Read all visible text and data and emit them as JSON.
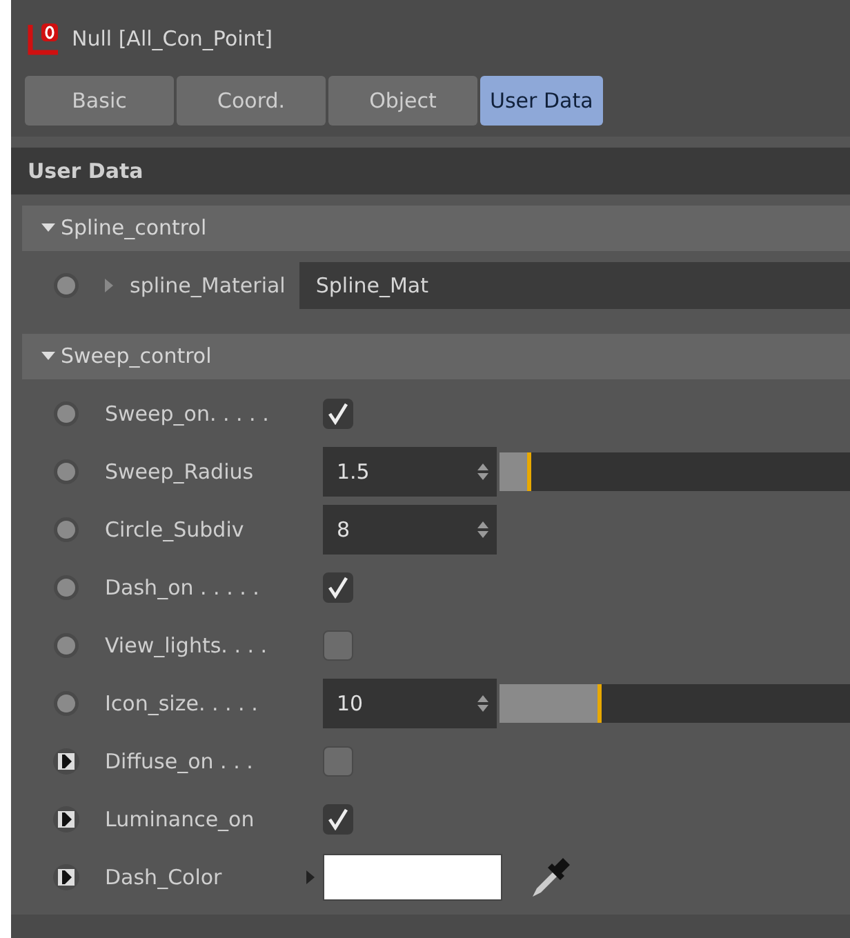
{
  "window": {
    "title": "Null [All_Con_Point]"
  },
  "tabs": [
    {
      "label": "Basic",
      "selected": false
    },
    {
      "label": "Coord.",
      "selected": false
    },
    {
      "label": "Object",
      "selected": false
    },
    {
      "label": "User Data",
      "selected": true
    }
  ],
  "section_title": "User Data",
  "groups": [
    {
      "title": "Spline_control",
      "expanded": true,
      "rows": [
        {
          "kind": "link",
          "keyframed": false,
          "label": "spline_Material",
          "value": "Spline_Mat"
        }
      ]
    },
    {
      "title": "Sweep_control",
      "expanded": true,
      "rows": [
        {
          "kind": "checkbox",
          "keyframed": false,
          "label": "Sweep_on. . . . .",
          "checked": true
        },
        {
          "kind": "number",
          "keyframed": false,
          "label": "Sweep_Radius",
          "value": "1.5",
          "level": 0.09
        },
        {
          "kind": "number",
          "keyframed": false,
          "label": "Circle_Subdiv",
          "value": "8"
        },
        {
          "kind": "checkbox",
          "keyframed": false,
          "label": "Dash_on . . . . .",
          "checked": true
        },
        {
          "kind": "checkbox",
          "keyframed": false,
          "label": "View_lights. . . .",
          "checked": false
        },
        {
          "kind": "number",
          "keyframed": false,
          "label": "Icon_size. . . . .",
          "value": "10",
          "level": 0.29
        },
        {
          "kind": "checkbox",
          "keyframed": true,
          "label": "Diffuse_on . . .",
          "checked": false
        },
        {
          "kind": "checkbox",
          "keyframed": true,
          "label": "Luminance_on",
          "checked": true
        },
        {
          "kind": "color",
          "keyframed": true,
          "label": "Dash_Color",
          "color": "#ffffff"
        }
      ]
    }
  ]
}
